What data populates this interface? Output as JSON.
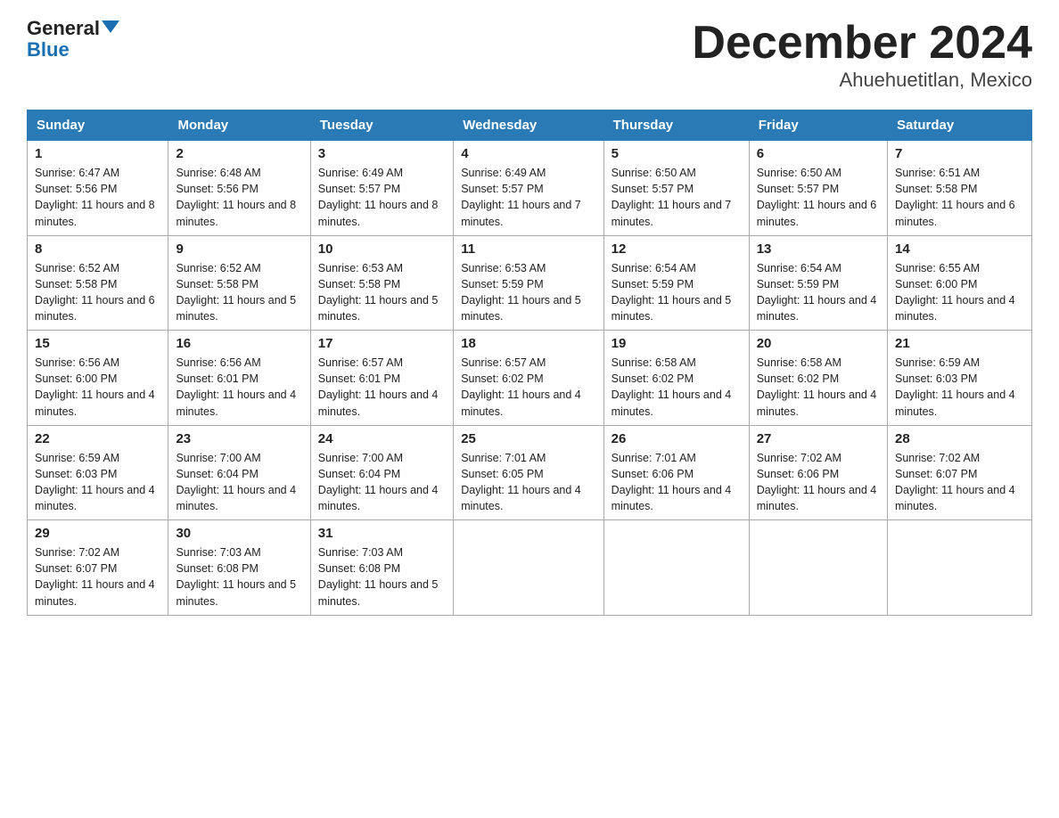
{
  "logo": {
    "text1": "General",
    "text2": "Blue"
  },
  "title": "December 2024",
  "subtitle": "Ahuehuetitlan, Mexico",
  "days_of_week": [
    "Sunday",
    "Monday",
    "Tuesday",
    "Wednesday",
    "Thursday",
    "Friday",
    "Saturday"
  ],
  "weeks": [
    [
      {
        "day": "1",
        "sunrise": "6:47 AM",
        "sunset": "5:56 PM",
        "daylight": "11 hours and 8 minutes."
      },
      {
        "day": "2",
        "sunrise": "6:48 AM",
        "sunset": "5:56 PM",
        "daylight": "11 hours and 8 minutes."
      },
      {
        "day": "3",
        "sunrise": "6:49 AM",
        "sunset": "5:57 PM",
        "daylight": "11 hours and 8 minutes."
      },
      {
        "day": "4",
        "sunrise": "6:49 AM",
        "sunset": "5:57 PM",
        "daylight": "11 hours and 7 minutes."
      },
      {
        "day": "5",
        "sunrise": "6:50 AM",
        "sunset": "5:57 PM",
        "daylight": "11 hours and 7 minutes."
      },
      {
        "day": "6",
        "sunrise": "6:50 AM",
        "sunset": "5:57 PM",
        "daylight": "11 hours and 6 minutes."
      },
      {
        "day": "7",
        "sunrise": "6:51 AM",
        "sunset": "5:58 PM",
        "daylight": "11 hours and 6 minutes."
      }
    ],
    [
      {
        "day": "8",
        "sunrise": "6:52 AM",
        "sunset": "5:58 PM",
        "daylight": "11 hours and 6 minutes."
      },
      {
        "day": "9",
        "sunrise": "6:52 AM",
        "sunset": "5:58 PM",
        "daylight": "11 hours and 5 minutes."
      },
      {
        "day": "10",
        "sunrise": "6:53 AM",
        "sunset": "5:58 PM",
        "daylight": "11 hours and 5 minutes."
      },
      {
        "day": "11",
        "sunrise": "6:53 AM",
        "sunset": "5:59 PM",
        "daylight": "11 hours and 5 minutes."
      },
      {
        "day": "12",
        "sunrise": "6:54 AM",
        "sunset": "5:59 PM",
        "daylight": "11 hours and 5 minutes."
      },
      {
        "day": "13",
        "sunrise": "6:54 AM",
        "sunset": "5:59 PM",
        "daylight": "11 hours and 4 minutes."
      },
      {
        "day": "14",
        "sunrise": "6:55 AM",
        "sunset": "6:00 PM",
        "daylight": "11 hours and 4 minutes."
      }
    ],
    [
      {
        "day": "15",
        "sunrise": "6:56 AM",
        "sunset": "6:00 PM",
        "daylight": "11 hours and 4 minutes."
      },
      {
        "day": "16",
        "sunrise": "6:56 AM",
        "sunset": "6:01 PM",
        "daylight": "11 hours and 4 minutes."
      },
      {
        "day": "17",
        "sunrise": "6:57 AM",
        "sunset": "6:01 PM",
        "daylight": "11 hours and 4 minutes."
      },
      {
        "day": "18",
        "sunrise": "6:57 AM",
        "sunset": "6:02 PM",
        "daylight": "11 hours and 4 minutes."
      },
      {
        "day": "19",
        "sunrise": "6:58 AM",
        "sunset": "6:02 PM",
        "daylight": "11 hours and 4 minutes."
      },
      {
        "day": "20",
        "sunrise": "6:58 AM",
        "sunset": "6:02 PM",
        "daylight": "11 hours and 4 minutes."
      },
      {
        "day": "21",
        "sunrise": "6:59 AM",
        "sunset": "6:03 PM",
        "daylight": "11 hours and 4 minutes."
      }
    ],
    [
      {
        "day": "22",
        "sunrise": "6:59 AM",
        "sunset": "6:03 PM",
        "daylight": "11 hours and 4 minutes."
      },
      {
        "day": "23",
        "sunrise": "7:00 AM",
        "sunset": "6:04 PM",
        "daylight": "11 hours and 4 minutes."
      },
      {
        "day": "24",
        "sunrise": "7:00 AM",
        "sunset": "6:04 PM",
        "daylight": "11 hours and 4 minutes."
      },
      {
        "day": "25",
        "sunrise": "7:01 AM",
        "sunset": "6:05 PM",
        "daylight": "11 hours and 4 minutes."
      },
      {
        "day": "26",
        "sunrise": "7:01 AM",
        "sunset": "6:06 PM",
        "daylight": "11 hours and 4 minutes."
      },
      {
        "day": "27",
        "sunrise": "7:02 AM",
        "sunset": "6:06 PM",
        "daylight": "11 hours and 4 minutes."
      },
      {
        "day": "28",
        "sunrise": "7:02 AM",
        "sunset": "6:07 PM",
        "daylight": "11 hours and 4 minutes."
      }
    ],
    [
      {
        "day": "29",
        "sunrise": "7:02 AM",
        "sunset": "6:07 PM",
        "daylight": "11 hours and 4 minutes."
      },
      {
        "day": "30",
        "sunrise": "7:03 AM",
        "sunset": "6:08 PM",
        "daylight": "11 hours and 5 minutes."
      },
      {
        "day": "31",
        "sunrise": "7:03 AM",
        "sunset": "6:08 PM",
        "daylight": "11 hours and 5 minutes."
      },
      null,
      null,
      null,
      null
    ]
  ]
}
